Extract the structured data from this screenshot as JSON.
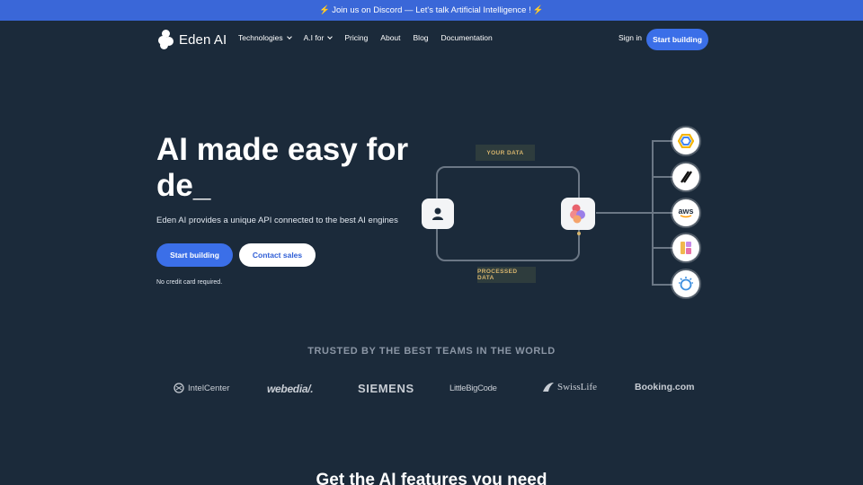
{
  "announcement": {
    "bolt_left": "⚡",
    "text": "Join us on Discord — Let's talk Artificial Intelligence !",
    "bolt_right": "⚡"
  },
  "nav": {
    "logo_text": "Eden AI",
    "items": [
      {
        "label": "Technologies",
        "dropdown": true
      },
      {
        "label": "A.I for",
        "dropdown": true
      },
      {
        "label": "Pricing"
      },
      {
        "label": "About"
      },
      {
        "label": "Blog"
      },
      {
        "label": "Documentation"
      }
    ],
    "sign_in": "Sign in",
    "cta": "Start building"
  },
  "hero": {
    "title_line1": "AI made easy for",
    "title_line2": "de_",
    "subtitle": "Eden AI provides a unique API connected to the best AI engines",
    "primary_button": "Start building",
    "secondary_button": "Contact sales",
    "note": "No credit card required."
  },
  "diagram": {
    "top_tag": "YOUR DATA",
    "bottom_tag": "PROCESSED DATA",
    "providers": [
      "google-cloud-icon",
      "stripes-logo-icon",
      "aws",
      "gradient-logo-icon",
      "ibm-watson-icon"
    ],
    "aws_label": "aws"
  },
  "trusted": {
    "heading": "TRUSTED BY THE BEST TEAMS IN THE WORLD",
    "logos": [
      "IntelCenter",
      "webedia/.",
      "SIEMENS",
      "LittleBigCode",
      "SwissLife",
      "Booking.com"
    ]
  },
  "next_section": {
    "title": "Get the AI features you need"
  },
  "colors": {
    "background": "#1b2a3a",
    "accent": "#3b6fe8",
    "tag_text": "#d7b56d"
  }
}
